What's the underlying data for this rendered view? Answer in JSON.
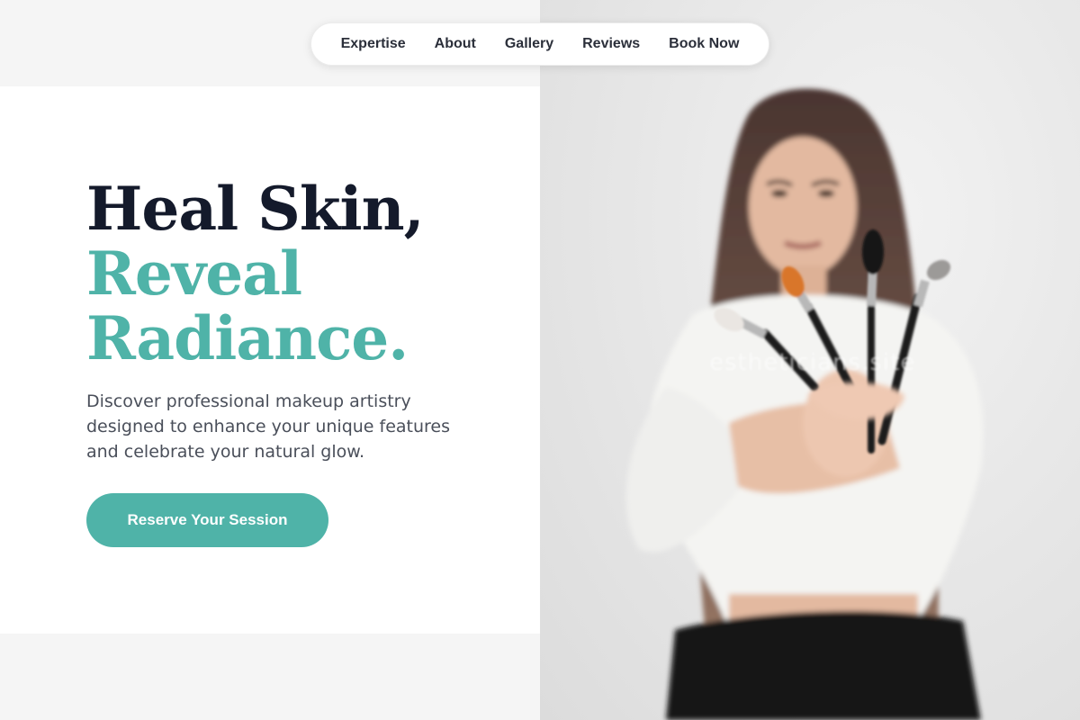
{
  "nav": {
    "items": [
      {
        "label": "Expertise"
      },
      {
        "label": "About"
      },
      {
        "label": "Gallery"
      },
      {
        "label": "Reviews"
      },
      {
        "label": "Book Now"
      }
    ]
  },
  "hero": {
    "headline_line1": "Heal Skin,",
    "headline_line2": "Reveal",
    "headline_line3": "Radiance.",
    "description": "Discover professional makeup artistry designed to enhance your unique features and celebrate your natural glow.",
    "cta_label": "Reserve Your Session",
    "watermark": "estheticians.site"
  },
  "colors": {
    "accent": "#4fb3a8",
    "heading": "#141a2b",
    "body_text": "#4a4f5a",
    "page_bg": "#f5f5f5"
  },
  "icons": []
}
